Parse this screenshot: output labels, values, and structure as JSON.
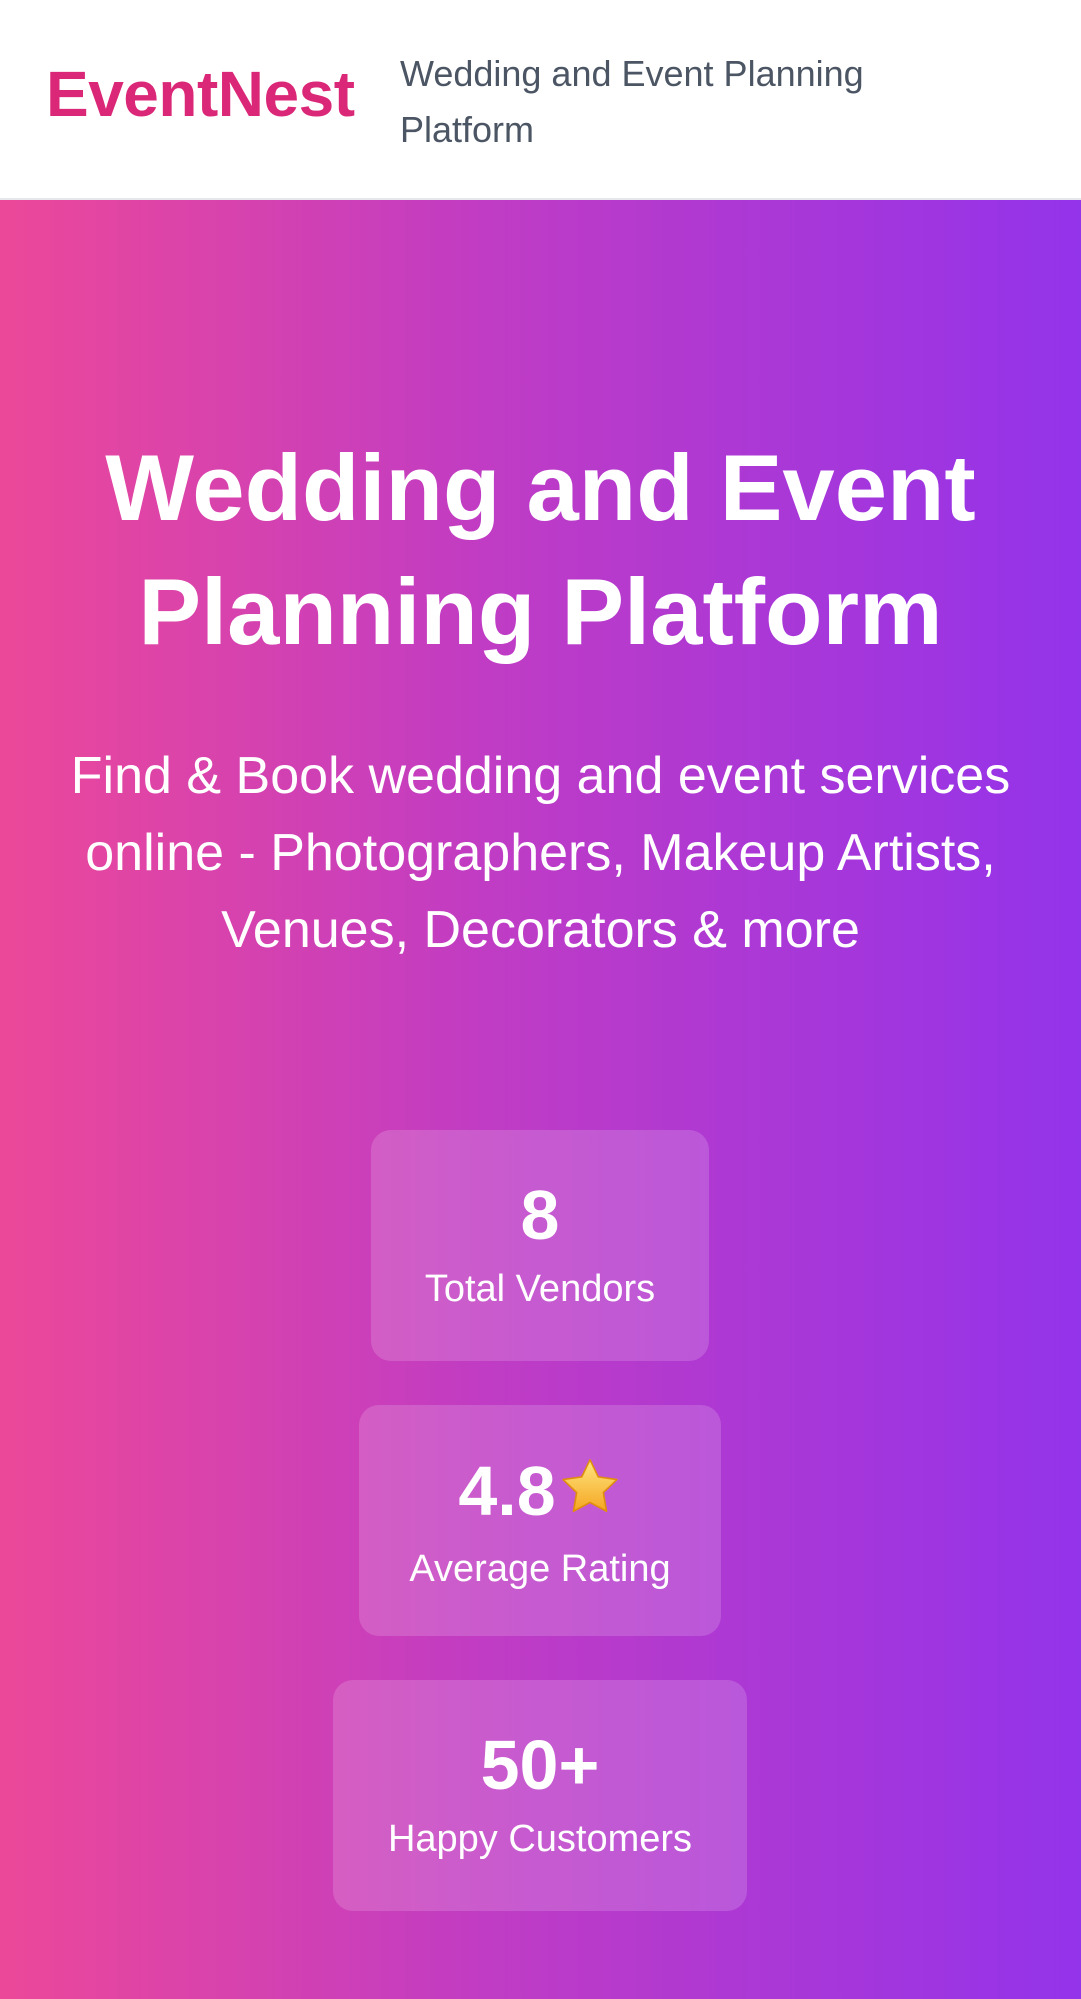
{
  "header": {
    "logo": "EventNest",
    "tagline": "Wedding and Event Planning Platform"
  },
  "hero": {
    "title": "Wedding and Event Planning Platform",
    "subtitle": "Find & Book wedding and event services online - Photographers, Makeup Artists, Venues, Decorators & more",
    "stats": [
      {
        "value": "8",
        "label": "Total Vendors"
      },
      {
        "value": "4.8",
        "icon": "star-icon",
        "label": "Average Rating"
      },
      {
        "value": "50+",
        "label": "Happy Customers"
      }
    ]
  },
  "colors": {
    "brand": "#db2777",
    "gradient_start": "#ec4899",
    "gradient_end": "#9333ea"
  }
}
